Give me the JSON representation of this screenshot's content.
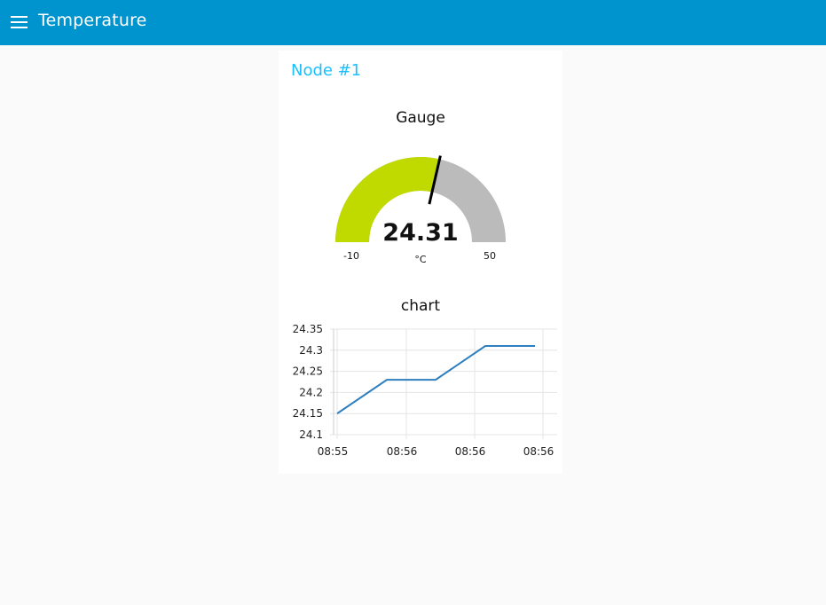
{
  "header": {
    "title": "Temperature",
    "menu_icon": "menu-icon",
    "bar_color": "#0094ce"
  },
  "group": {
    "title": "Node #1",
    "title_color": "#1bbfff"
  },
  "gauge": {
    "title": "Gauge",
    "value": 24.31,
    "value_text": "24.31",
    "units": "°C",
    "min": -10,
    "max": 50,
    "min_label": "-10",
    "max_label": "50",
    "fill_color": "#c0da00",
    "track_color": "#bbbbbb",
    "needle_color": "#000000"
  },
  "chart": {
    "title": "chart"
  },
  "chart_data": {
    "type": "line",
    "title": "chart",
    "x": [
      "08:55",
      "08:55",
      "08:56",
      "08:56",
      "08:56",
      "08:56"
    ],
    "series": [
      {
        "values": [
          24.15,
          24.23,
          24.23,
          24.31,
          24.31
        ]
      }
    ],
    "x_tick_labels": [
      "08:55",
      "08:56",
      "08:56",
      "08:56"
    ],
    "y_tick_labels": [
      "24.35",
      "24.3",
      "24.25",
      "24.2",
      "24.15",
      "24.1"
    ],
    "ylim": [
      24.1,
      24.35
    ],
    "grid": true,
    "line_color": "#2e7fbf"
  }
}
